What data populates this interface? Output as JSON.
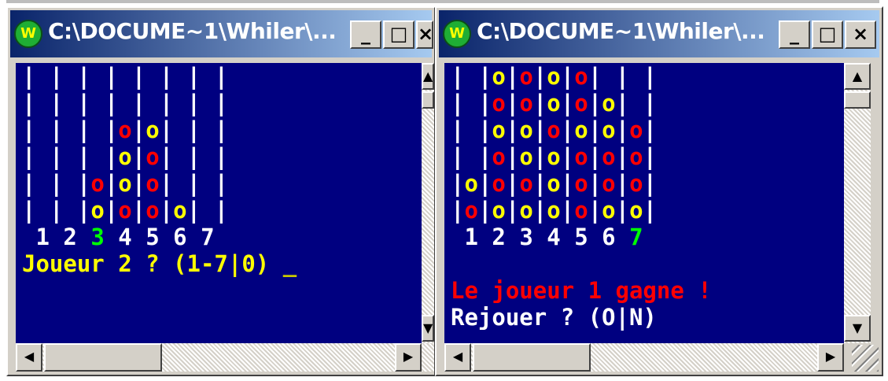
{
  "window_left": {
    "title": "C:\\DOCUME~1\\Whiler\\...",
    "board_rows": [
      [
        " ",
        " ",
        " ",
        " ",
        " ",
        " ",
        " "
      ],
      [
        " ",
        " ",
        " ",
        " ",
        " ",
        " ",
        " "
      ],
      [
        " ",
        " ",
        " ",
        "r",
        "y",
        " ",
        " "
      ],
      [
        " ",
        " ",
        " ",
        "y",
        "r",
        " ",
        " "
      ],
      [
        " ",
        " ",
        "r",
        "y",
        "r",
        " ",
        " "
      ],
      [
        " ",
        " ",
        "y",
        "r",
        "r",
        "y",
        " "
      ]
    ],
    "column_numbers": [
      "1",
      "2",
      "3",
      "4",
      "5",
      "6",
      "7"
    ],
    "highlight_column": 3,
    "prompt": "Joueur 2 ? (1-7|0)",
    "cursor": "_"
  },
  "window_right": {
    "title": "C:\\DOCUME~1\\Whiler\\...",
    "board_rows": [
      [
        " ",
        "y",
        "r",
        "y",
        "r",
        " ",
        " "
      ],
      [
        " ",
        "r",
        "r",
        "y",
        "r",
        "y",
        " "
      ],
      [
        " ",
        "y",
        "y",
        "r",
        "y",
        "y",
        "r"
      ],
      [
        " ",
        "r",
        "y",
        "y",
        "r",
        "r",
        "r"
      ],
      [
        "y",
        "r",
        "r",
        "y",
        "r",
        "r",
        "r"
      ],
      [
        "r",
        "y",
        "y",
        "y",
        "r",
        "y",
        "y"
      ]
    ],
    "column_numbers": [
      "1",
      "2",
      "3",
      "4",
      "5",
      "6",
      "7"
    ],
    "highlight_column": 7,
    "win_message": "Le joueur 1 gagne !",
    "replay_prompt": "Rejouer ? (O|N)"
  },
  "colors": {
    "console_bg": "#000080",
    "yellow_disc": "#ffff00",
    "red_disc": "#ff0000",
    "highlight": "#00ff00"
  },
  "icons": {
    "app": "green-circle-app-icon",
    "minimize": "minimize-icon",
    "maximize": "maximize-icon",
    "close": "close-icon",
    "up": "arrow-up-icon",
    "down": "arrow-down-icon",
    "left": "arrow-left-icon",
    "right": "arrow-right-icon"
  }
}
